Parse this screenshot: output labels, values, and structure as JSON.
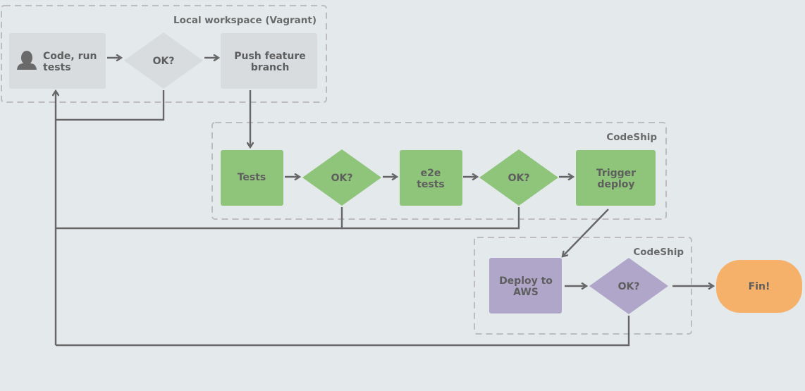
{
  "groups": {
    "local": "Local workspace (Vagrant)",
    "codeship_ci": "CodeShip",
    "codeship_deploy": "CodeShip"
  },
  "nodes": {
    "code": [
      "Code, run",
      "tests"
    ],
    "ok1": "OK?",
    "push": [
      "Push feature",
      "branch"
    ],
    "tests": "Tests",
    "ok2": "OK?",
    "e2e": [
      "e2e",
      "tests"
    ],
    "ok3": "OK?",
    "trigger": [
      "Trigger",
      "deploy"
    ],
    "deploy": [
      "Deploy to",
      "AWS"
    ],
    "ok4": "OK?",
    "fin": "Fin!"
  },
  "icons": {
    "developer": "user-icon"
  },
  "colors": {
    "background": "#e4e9ec",
    "local_step": "#d8dcdf",
    "ci_step": "#8fc57a",
    "deploy_step": "#b0a6c9",
    "end": "#f5b16a",
    "connector": "#666666"
  }
}
